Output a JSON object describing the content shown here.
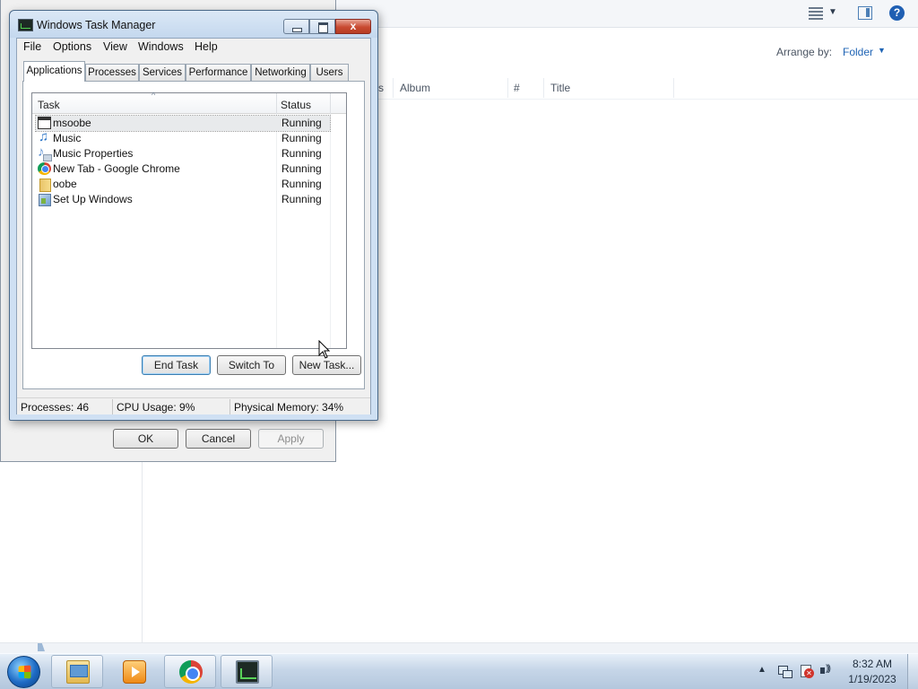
{
  "explorer": {
    "arrange_label": "Arrange by:",
    "arrange_value": "Folder",
    "columns": {
      "partial": "s",
      "album": "Album",
      "number": "#",
      "title": "Title"
    }
  },
  "props_dialog": {
    "ok_label": "OK",
    "cancel_label": "Cancel",
    "apply_label": "Apply"
  },
  "taskmgr": {
    "title": "Windows Task Manager",
    "close_glyph": "x",
    "menu": [
      "File",
      "Options",
      "View",
      "Windows",
      "Help"
    ],
    "tabs": [
      "Applications",
      "Processes",
      "Services",
      "Performance",
      "Networking",
      "Users"
    ],
    "active_tab": "Applications",
    "list": {
      "col_task": "Task",
      "col_status": "Status",
      "sort_glyph": "^",
      "rows": [
        {
          "name": "msoobe",
          "status": "Running",
          "icon": "window-icon"
        },
        {
          "name": "Music",
          "status": "Running",
          "icon": "music-note-icon"
        },
        {
          "name": "Music Properties",
          "status": "Running",
          "icon": "music-properties-icon"
        },
        {
          "name": "New Tab - Google Chrome",
          "status": "Running",
          "icon": "chrome-icon"
        },
        {
          "name": "oobe",
          "status": "Running",
          "icon": "folder-icon"
        },
        {
          "name": "Set Up Windows",
          "status": "Running",
          "icon": "setup-icon"
        }
      ]
    },
    "buttons": {
      "end_task": "End Task",
      "switch_to": "Switch To",
      "new_task": "New Task..."
    },
    "status": {
      "processes": "Processes: 46",
      "cpu": "CPU Usage: 9%",
      "memory": "Physical Memory: 34%"
    }
  },
  "taskbar": {
    "apps": [
      "windows-explorer",
      "windows-media-player",
      "google-chrome",
      "task-manager"
    ],
    "tray_arrow": "▲",
    "clock_time": "8:32 AM",
    "clock_date": "1/19/2023"
  },
  "colors": {
    "link_blue": "#1e63b4",
    "titlebar": "#c4d8ee",
    "close_red": "#c84a31"
  }
}
